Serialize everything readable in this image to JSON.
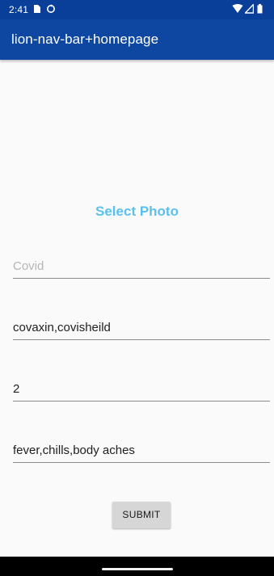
{
  "status_bar": {
    "time": "2:41",
    "icons": [
      "sim-card-icon",
      "sync-icon",
      "wifi-icon",
      "signal-icon",
      "battery-icon"
    ]
  },
  "app_bar": {
    "title": "lion-nav-bar+homepage"
  },
  "main": {
    "select_photo_label": "Select Photo",
    "fields": [
      {
        "value": "",
        "placeholder": "Covid"
      },
      {
        "value": "covaxin,covisheild",
        "placeholder": ""
      },
      {
        "value": "2",
        "placeholder": ""
      },
      {
        "value": "fever,chills,body aches",
        "placeholder": ""
      }
    ],
    "submit_label": "SUBMIT"
  },
  "colors": {
    "status_bar": "#0a3f99",
    "app_bar": "#0d47a1",
    "accent": "#5bc0f0",
    "background": "#fafafa",
    "button": "#d6d6d6"
  }
}
